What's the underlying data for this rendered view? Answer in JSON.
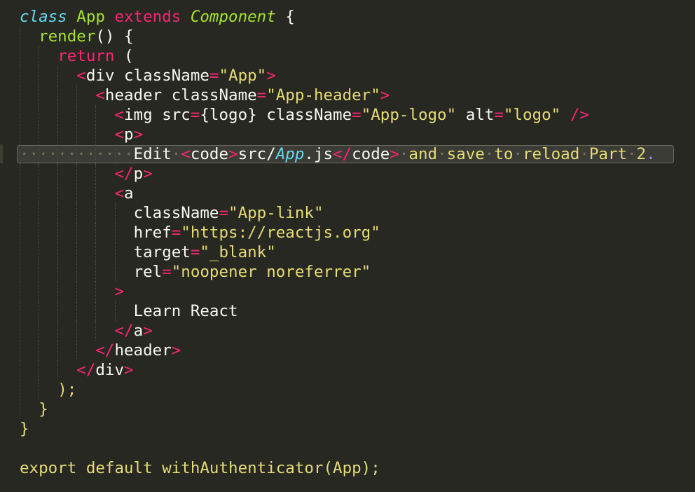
{
  "editor": {
    "lines": [
      [
        {
          "t": "class",
          "c": "tok-stor-it"
        },
        {
          "t": " ",
          "c": "tok-plain"
        },
        {
          "t": "App",
          "c": "tok-cls"
        },
        {
          "t": " ",
          "c": "tok-plain"
        },
        {
          "t": "extends",
          "c": "tok-kw"
        },
        {
          "t": " ",
          "c": "tok-plain"
        },
        {
          "t": "Component",
          "c": "tok-inh"
        },
        {
          "t": " {",
          "c": "tok-brace"
        }
      ],
      [
        {
          "t": "  ",
          "c": "tok-plain"
        },
        {
          "t": "render",
          "c": "tok-fn"
        },
        {
          "t": "() {",
          "c": "tok-brace"
        }
      ],
      [
        {
          "t": "    ",
          "c": "tok-plain"
        },
        {
          "t": "return",
          "c": "tok-kw"
        },
        {
          "t": " (",
          "c": "tok-brace"
        }
      ],
      [
        {
          "t": "      ",
          "c": "tok-plain"
        },
        {
          "t": "<",
          "c": "tok-tag"
        },
        {
          "t": "div",
          "c": "tok-plain"
        },
        {
          "t": " className",
          "c": "tok-attr"
        },
        {
          "t": "=",
          "c": "tok-kw"
        },
        {
          "t": "\"App\"",
          "c": "tok-str"
        },
        {
          "t": ">",
          "c": "tok-tag"
        }
      ],
      [
        {
          "t": "        ",
          "c": "tok-plain"
        },
        {
          "t": "<",
          "c": "tok-tag"
        },
        {
          "t": "header",
          "c": "tok-plain"
        },
        {
          "t": " className",
          "c": "tok-attr"
        },
        {
          "t": "=",
          "c": "tok-kw"
        },
        {
          "t": "\"App-header\"",
          "c": "tok-str"
        },
        {
          "t": ">",
          "c": "tok-tag"
        }
      ],
      [
        {
          "t": "          ",
          "c": "tok-plain"
        },
        {
          "t": "<",
          "c": "tok-tag"
        },
        {
          "t": "img",
          "c": "tok-plain"
        },
        {
          "t": " src",
          "c": "tok-attr"
        },
        {
          "t": "=",
          "c": "tok-kw"
        },
        {
          "t": "{logo}",
          "c": "tok-brace"
        },
        {
          "t": " className",
          "c": "tok-attr"
        },
        {
          "t": "=",
          "c": "tok-kw"
        },
        {
          "t": "\"App-logo\"",
          "c": "tok-str"
        },
        {
          "t": " alt",
          "c": "tok-attr"
        },
        {
          "t": "=",
          "c": "tok-kw"
        },
        {
          "t": "\"logo\"",
          "c": "tok-str"
        },
        {
          "t": " ",
          "c": "tok-plain"
        },
        {
          "t": "/>",
          "c": "tok-tag"
        }
      ],
      [
        {
          "t": "          ",
          "c": "tok-plain"
        },
        {
          "t": "<",
          "c": "tok-tag"
        },
        {
          "t": "p",
          "c": "tok-plain"
        },
        {
          "t": ">",
          "c": "tok-tag"
        }
      ],
      [
        {
          "t": "············",
          "c": "ws"
        },
        {
          "t": "Edit",
          "c": "tok-text"
        },
        {
          "t": "·",
          "c": "ws"
        },
        {
          "t": "<",
          "c": "tok-tag"
        },
        {
          "t": "code",
          "c": "tok-plain"
        },
        {
          "t": ">",
          "c": "tok-tag"
        },
        {
          "t": "src/",
          "c": "tok-text"
        },
        {
          "t": "App",
          "c": "tok-comp"
        },
        {
          "t": ".js",
          "c": "tok-text"
        },
        {
          "t": "</",
          "c": "tok-tag"
        },
        {
          "t": "code",
          "c": "tok-plain"
        },
        {
          "t": ">",
          "c": "tok-tag"
        },
        {
          "t": "·",
          "c": "ws"
        },
        {
          "t": "and",
          "c": "tok-yellow"
        },
        {
          "t": "·",
          "c": "ws"
        },
        {
          "t": "save",
          "c": "tok-yellow"
        },
        {
          "t": "·",
          "c": "ws"
        },
        {
          "t": "to",
          "c": "tok-yellow"
        },
        {
          "t": "·",
          "c": "ws"
        },
        {
          "t": "reload",
          "c": "tok-yellow"
        },
        {
          "t": "·",
          "c": "ws"
        },
        {
          "t": "Part",
          "c": "tok-yellow"
        },
        {
          "t": "·",
          "c": "ws"
        },
        {
          "t": "2",
          "c": "tok-yellow"
        },
        {
          "t": ".",
          "c": "tok-cursor"
        }
      ],
      [
        {
          "t": "          ",
          "c": "tok-plain"
        },
        {
          "t": "</",
          "c": "tok-tag"
        },
        {
          "t": "p",
          "c": "tok-plain"
        },
        {
          "t": ">",
          "c": "tok-tag"
        }
      ],
      [
        {
          "t": "          ",
          "c": "tok-plain"
        },
        {
          "t": "<",
          "c": "tok-tag"
        },
        {
          "t": "a",
          "c": "tok-plain"
        }
      ],
      [
        {
          "t": "            ",
          "c": "tok-plain"
        },
        {
          "t": "className",
          "c": "tok-attr"
        },
        {
          "t": "=",
          "c": "tok-kw"
        },
        {
          "t": "\"App-link\"",
          "c": "tok-str"
        }
      ],
      [
        {
          "t": "            ",
          "c": "tok-plain"
        },
        {
          "t": "href",
          "c": "tok-attr"
        },
        {
          "t": "=",
          "c": "tok-kw"
        },
        {
          "t": "\"https://reactjs.org\"",
          "c": "tok-str"
        }
      ],
      [
        {
          "t": "            ",
          "c": "tok-plain"
        },
        {
          "t": "target",
          "c": "tok-attr"
        },
        {
          "t": "=",
          "c": "tok-kw"
        },
        {
          "t": "\"_blank\"",
          "c": "tok-str"
        }
      ],
      [
        {
          "t": "            ",
          "c": "tok-plain"
        },
        {
          "t": "rel",
          "c": "tok-attr"
        },
        {
          "t": "=",
          "c": "tok-kw"
        },
        {
          "t": "\"noopener noreferrer\"",
          "c": "tok-str"
        }
      ],
      [
        {
          "t": "          ",
          "c": "tok-plain"
        },
        {
          "t": ">",
          "c": "tok-tag"
        }
      ],
      [
        {
          "t": "            ",
          "c": "tok-plain"
        },
        {
          "t": "Learn React",
          "c": "tok-text"
        }
      ],
      [
        {
          "t": "          ",
          "c": "tok-plain"
        },
        {
          "t": "</",
          "c": "tok-tag"
        },
        {
          "t": "a",
          "c": "tok-plain"
        },
        {
          "t": ">",
          "c": "tok-tag"
        }
      ],
      [
        {
          "t": "        ",
          "c": "tok-plain"
        },
        {
          "t": "</",
          "c": "tok-tag"
        },
        {
          "t": "header",
          "c": "tok-plain"
        },
        {
          "t": ">",
          "c": "tok-tag"
        }
      ],
      [
        {
          "t": "      ",
          "c": "tok-plain"
        },
        {
          "t": "</",
          "c": "tok-tag"
        },
        {
          "t": "div",
          "c": "tok-plain"
        },
        {
          "t": ">",
          "c": "tok-tag"
        }
      ],
      [
        {
          "t": "    ",
          "c": "tok-plain"
        },
        {
          "t": ");",
          "c": "tok-yellow"
        }
      ],
      [
        {
          "t": "  ",
          "c": "tok-plain"
        },
        {
          "t": "}",
          "c": "tok-yellow"
        }
      ],
      [
        {
          "t": "}",
          "c": "tok-yellow"
        }
      ],
      [],
      [
        {
          "t": "export",
          "c": "tok-yellow"
        },
        {
          "t": " ",
          "c": "tok-plain"
        },
        {
          "t": "default",
          "c": "tok-yellow"
        },
        {
          "t": " ",
          "c": "tok-plain"
        },
        {
          "t": "withAuthenticator(App);",
          "c": "tok-yellow"
        }
      ]
    ],
    "current_line": 7,
    "colors": {
      "background": "#272822",
      "keyword": "#f92672",
      "string": "#e6db74",
      "function": "#a6e22e",
      "storage": "#66d9ef",
      "text": "#f8f8f2",
      "guide": "#4d4c44",
      "line_highlight": "#3b3c35"
    }
  }
}
